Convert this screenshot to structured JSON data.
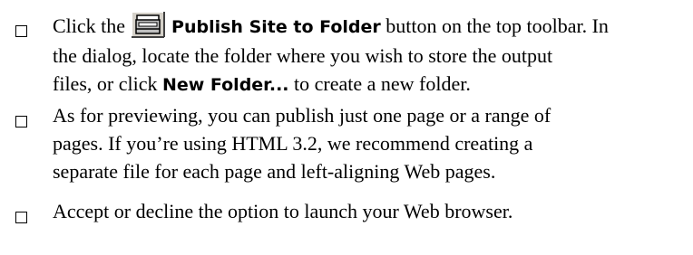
{
  "steps": [
    {
      "part1": "Click the",
      "button_name": "Publish Site to Folder",
      "part2": "button on the top toolbar. In",
      "line2": "the dialog, locate the folder where you wish to store the output",
      "line3_a": "files, or click",
      "new_folder_label": "New Folder...",
      "line3_b": "to create a new folder.",
      "icon": "publish-site-to-folder-icon"
    },
    {
      "line1": "As for previewing, you can publish just one page or a range of",
      "line2": "pages. If you’re using HTML 3.2, we recommend creating a",
      "line3": "separate file for each page and left-aligning Web pages."
    },
    {
      "line1": "Accept or decline the option to launch your Web browser."
    }
  ]
}
